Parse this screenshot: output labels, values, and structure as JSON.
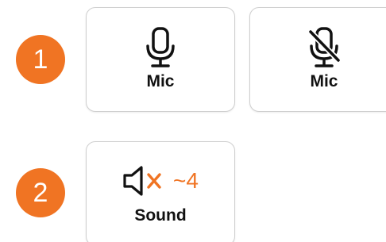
{
  "colors": {
    "accent": "#f07423",
    "tile_border": "#cfcfcf",
    "text": "#111111"
  },
  "steps": [
    {
      "number": "1"
    },
    {
      "number": "2"
    }
  ],
  "tiles": {
    "mic_on": {
      "label": "Mic",
      "icon": "microphone-icon"
    },
    "mic_off": {
      "label": "Mic",
      "icon": "microphone-muted-icon"
    },
    "sound": {
      "label": "Sound",
      "icon": "speaker-muted-icon",
      "level_text": "~4"
    }
  }
}
